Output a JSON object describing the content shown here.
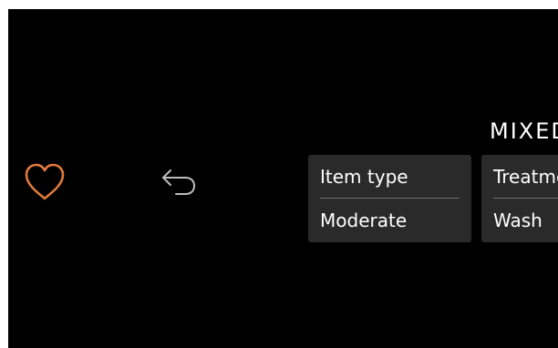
{
  "colors": {
    "favorite_accent": "#e07a3c",
    "icon_gray": "#bdbdbd",
    "card_bg": "#2a2a2a",
    "screen_bg": "#000000"
  },
  "header": {
    "program_title": "MIXED"
  },
  "toolbar": {
    "favorite_icon": "heart-icon",
    "back_icon": "undo-arrow-icon"
  },
  "settings": [
    {
      "label": "Item type",
      "value": "Moderate"
    },
    {
      "label": "Treatment",
      "value": "Wash"
    }
  ]
}
